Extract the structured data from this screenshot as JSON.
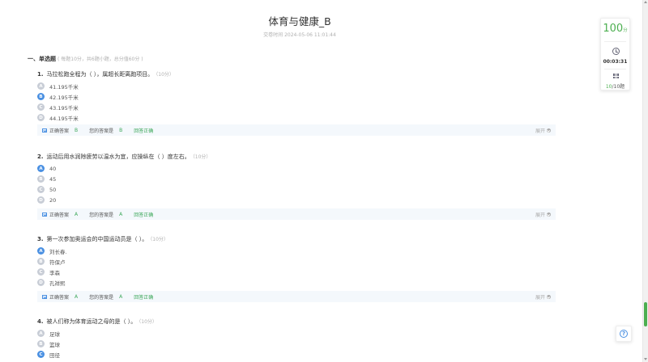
{
  "header": {
    "title": "体育与健康_B",
    "submit_time": "交卷时间 2024-05-06 11:01:44"
  },
  "section": {
    "title": "一、单选题",
    "desc": "( 每题10分，共6题小题，总分值60分 )"
  },
  "questions": [
    {
      "num": "1.",
      "text": "马拉松跑全程为（ ），属超长距离跑项目。",
      "score": "（10分）",
      "options": [
        {
          "letter": "A",
          "text": "41.195千米"
        },
        {
          "letter": "B",
          "text": "42.195千米"
        },
        {
          "letter": "C",
          "text": "43.195千米"
        },
        {
          "letter": "D",
          "text": "44.195千米"
        }
      ],
      "correct_label": "正确答案",
      "correct": "B",
      "yours_label": "您的答案是",
      "yours": "B",
      "result": "回答正确",
      "expand": "展开"
    },
    {
      "num": "2.",
      "text": "运动后用水润除疲劳以温水为宜，应操纵在（ ）度左右。",
      "score": "（10分）",
      "options": [
        {
          "letter": "A",
          "text": "40"
        },
        {
          "letter": "B",
          "text": "45"
        },
        {
          "letter": "C",
          "text": "50"
        },
        {
          "letter": "D",
          "text": "20"
        }
      ],
      "correct_label": "正确答案",
      "correct": "A",
      "yours_label": "您的答案是",
      "yours": "A",
      "result": "回答正确",
      "expand": "展开"
    },
    {
      "num": "3.",
      "text": "第一次参加奥运会的中国运动员是（ ）。",
      "score": "（10分）",
      "options": [
        {
          "letter": "A",
          "text": "刘长春."
        },
        {
          "letter": "B",
          "text": "符保卢"
        },
        {
          "letter": "C",
          "text": "李森"
        },
        {
          "letter": "D",
          "text": "孔祥熙"
        }
      ],
      "correct_label": "正确答案",
      "correct": "A",
      "yours_label": "您的答案是",
      "yours": "A",
      "result": "回答正确",
      "expand": "展开"
    },
    {
      "num": "4.",
      "text": "被人们称为体育运动之母的是（ ）。",
      "score": "（10分）",
      "options": [
        {
          "letter": "A",
          "text": "足球"
        },
        {
          "letter": "B",
          "text": "篮球"
        },
        {
          "letter": "C",
          "text": "田径"
        }
      ]
    }
  ],
  "side_card": {
    "score": "100",
    "score_unit": "分",
    "time": "00:03:31",
    "done": "10",
    "total": "/10",
    "count_unit": "题"
  },
  "help": {
    "glyph": "?"
  },
  "colors": {
    "accent": "#4a90e2",
    "correct": "#3ea85b",
    "score": "#4caf50"
  }
}
